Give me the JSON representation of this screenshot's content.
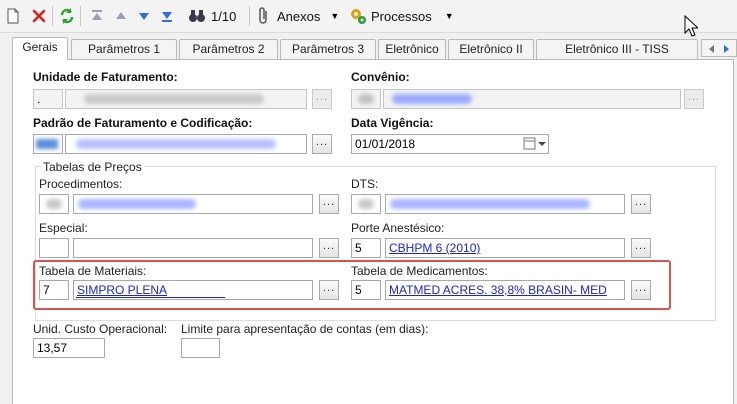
{
  "toolbar": {
    "record_counter": "1/10",
    "anexos_label": "Anexos",
    "processos_label": "Processos"
  },
  "tabs": [
    {
      "label": "Gerais"
    },
    {
      "label": "Parâmetros 1"
    },
    {
      "label": "Parâmetros 2"
    },
    {
      "label": "Parâmetros 3"
    },
    {
      "label": "Eletrônico"
    },
    {
      "label": "Eletrônico II"
    },
    {
      "label": "Eletrônico III - TISS"
    }
  ],
  "form": {
    "unidade_faturamento_label": "Unidade de Faturamento:",
    "unidade_faturamento_code": ".",
    "convenio_label": "Convênio:",
    "padrao_label": "Padrão de Faturamento e Codificação:",
    "data_vigencia_label": "Data Vigência:",
    "data_vigencia_value": "01/01/2018",
    "tabelas_group_label": "Tabelas de Preços",
    "procedimentos_label": "Procedimentos:",
    "dts_label": "DTS:",
    "especial_label": "Especial:",
    "porte_label": "Porte Anestésico:",
    "porte_code": "5",
    "porte_value": "CBHPM 6 (2010)",
    "materiais_label": "Tabela de Materiais:",
    "materiais_code": "7",
    "materiais_value": "SIMPRO PLENA",
    "medicamentos_label": "Tabela de Medicamentos:",
    "medicamentos_code": "5",
    "medicamentos_value": "MATMED ACRES. 38,8% BRASIN- MED",
    "unid_custo_label": "Unid. Custo Operacional:",
    "unid_custo_value": "13,57",
    "limite_label": "Limite para apresentação de contas (em dias):",
    "limite_value": "",
    "dots": "..."
  },
  "colors": {
    "link": "#1a27c9",
    "highlight": "#d9534f"
  }
}
